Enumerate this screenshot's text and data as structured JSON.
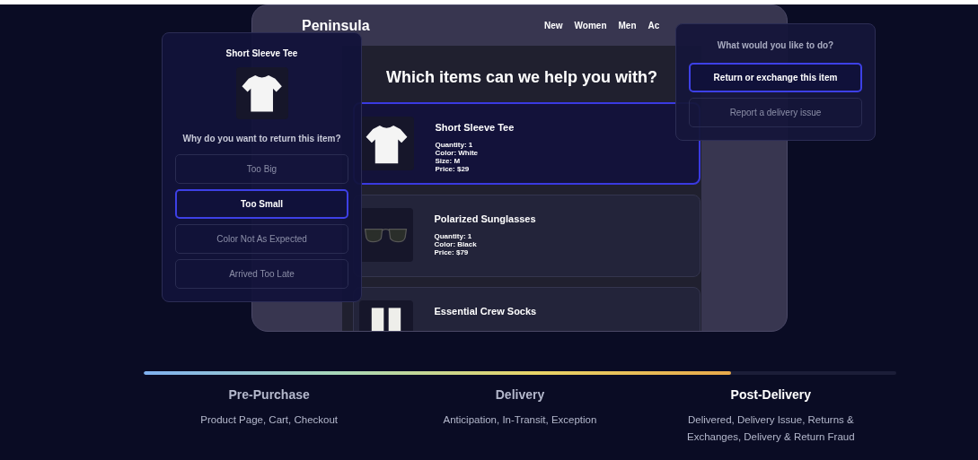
{
  "storefront": {
    "logo": "Peninsula",
    "nav": [
      "New",
      "Women",
      "Men",
      "Ac"
    ],
    "heading": "Which items can we help you with?",
    "items": [
      {
        "kind": "tee",
        "name": "Short Sleeve Tee",
        "details": [
          "Quantity: 1",
          "Color: White",
          "Size: M",
          "Price: $29"
        ],
        "selected": true
      },
      {
        "kind": "sunglasses",
        "name": "Polarized Sunglasses",
        "details": [
          "Quantity: 1",
          "Color: Black",
          "Price: $79"
        ],
        "selected": false
      },
      {
        "kind": "socks",
        "name": "Essential Crew Socks",
        "selected": false
      }
    ]
  },
  "reason_popup": {
    "title": "Short Sleeve Tee",
    "question": "Why do you want to return this item?",
    "options": [
      {
        "label": "Too Big",
        "selected": false
      },
      {
        "label": "Too Small",
        "selected": true
      },
      {
        "label": "Color Not As Expected",
        "selected": false
      },
      {
        "label": "Arrived Too Late",
        "selected": false
      }
    ]
  },
  "action_popup": {
    "question": "What would you like to do?",
    "options": [
      {
        "label": "Return or exchange this item",
        "selected": true
      },
      {
        "label": "Report a delivery issue",
        "selected": false
      }
    ]
  },
  "journey": {
    "level": 0.78,
    "stages": [
      {
        "title": "Pre-Purchase",
        "description": "Product Page, Cart, Checkout",
        "selected": false
      },
      {
        "title": "Delivery",
        "description": "Anticipation, In-Transit, Exception",
        "selected": false
      },
      {
        "title": "Post-Delivery",
        "description": "Delivered, Delivery Issue, Returns & Exchanges, Delivery & Return Fraud",
        "selected": true
      }
    ]
  }
}
